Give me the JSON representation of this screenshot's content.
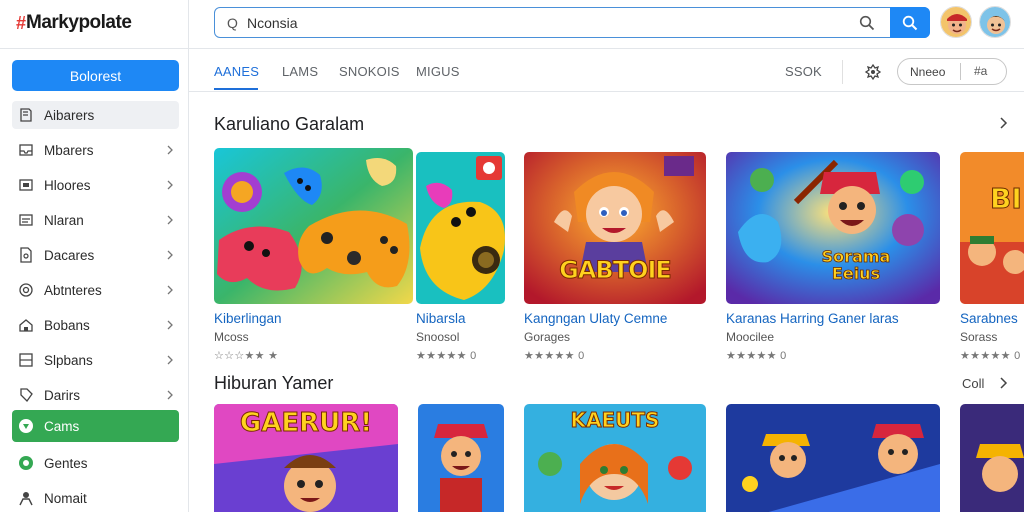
{
  "app": {
    "logo_mark": "#",
    "logo_text": "Markypolate"
  },
  "sidebar": {
    "primary_button": "Bolorest",
    "items": [
      {
        "label": "Aibarers",
        "icon": "book-icon",
        "chevron": false,
        "state": "highlight"
      },
      {
        "label": "Mbarers",
        "icon": "inbox-icon",
        "chevron": true,
        "state": ""
      },
      {
        "label": "Hloores",
        "icon": "box-icon",
        "chevron": true,
        "state": ""
      },
      {
        "label": "Nlaran",
        "icon": "mail-icon",
        "chevron": true,
        "state": ""
      },
      {
        "label": "Dacares",
        "icon": "document-icon",
        "chevron": true,
        "state": ""
      },
      {
        "label": "Abtnteres",
        "icon": "target-icon",
        "chevron": true,
        "state": ""
      },
      {
        "label": "Bobans",
        "icon": "house-icon",
        "chevron": true,
        "state": ""
      },
      {
        "label": "Slpbans",
        "icon": "grid-icon",
        "chevron": true,
        "state": ""
      },
      {
        "label": "Darirs",
        "icon": "tag-icon",
        "chevron": true,
        "state": ""
      },
      {
        "label": "Cams",
        "icon": "games-icon",
        "chevron": false,
        "state": "active"
      },
      {
        "label": "Gentes",
        "icon": "chat-icon",
        "chevron": false,
        "state": ""
      },
      {
        "label": "Nomait",
        "icon": "person-icon",
        "chevron": false,
        "state": ""
      }
    ]
  },
  "search": {
    "prefix": "Q",
    "value": "Nconsia"
  },
  "tabs": [
    {
      "label": "AANES",
      "active": true
    },
    {
      "label": "LAMS",
      "active": false
    },
    {
      "label": "SNOKOIS",
      "active": false
    },
    {
      "label": "MIGUS",
      "active": false
    }
  ],
  "toolbar": {
    "sort_label": "SSOK",
    "pill_label": "Nneeo",
    "pill_icon_text": "#a"
  },
  "sections": [
    {
      "title": "Karuliano Garalam",
      "more": "",
      "cards": [
        {
          "title": "Kiberlingan",
          "sub": "Mcoss",
          "rating": "☆☆☆★★ ★"
        },
        {
          "title": "Nibarsla",
          "sub": "Snoosol",
          "rating": "★★★★★ 0"
        },
        {
          "title": "Kangngan Ulaty Cemne",
          "sub": "Gorages",
          "rating": "★★★★★ 0"
        },
        {
          "title": "Karanas Harring Ganer laras",
          "sub": "Moocilee",
          "rating": "★★★★★ 0"
        },
        {
          "title": "Sarabnes",
          "sub": "Sorass",
          "rating": "★★★★★ 0"
        }
      ]
    },
    {
      "title": "Hiburan Yamer",
      "more": "Coll",
      "cards": [
        {
          "title": "",
          "sub": "",
          "rating": "",
          "banner": "GAERUR!"
        },
        {
          "title": "",
          "sub": "",
          "rating": "",
          "banner": ""
        },
        {
          "title": "",
          "sub": "",
          "rating": "",
          "banner": "KAEUTS"
        },
        {
          "title": "",
          "sub": "",
          "rating": "",
          "banner": ""
        },
        {
          "title": "",
          "sub": "",
          "rating": "",
          "banner": ""
        }
      ]
    }
  ],
  "thumb_banners": {
    "card_3": "GABTOIE",
    "card_4_line1": "Sorama",
    "card_4_line2": "Eeius",
    "card_5": "BI"
  },
  "colors": {
    "accent": "#1e88f5",
    "active_nav": "#34a853",
    "link": "#1565c0"
  }
}
